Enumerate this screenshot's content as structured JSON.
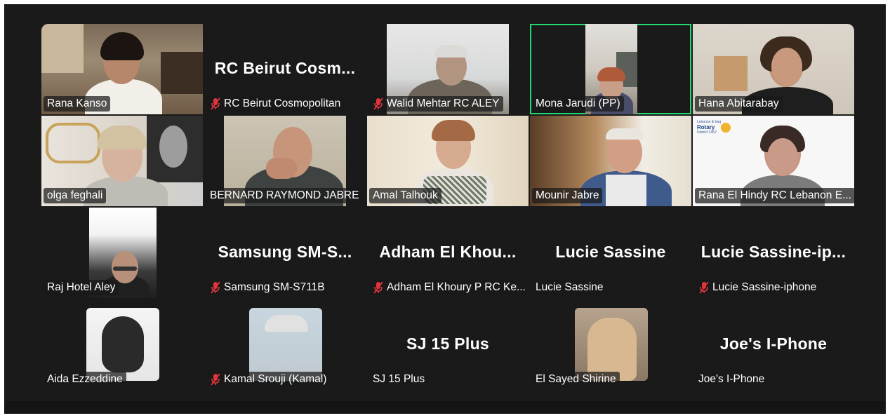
{
  "colors": {
    "background": "#1a1a1a",
    "active_speaker_border": "#23d96f",
    "muted_icon": "#e0353a",
    "label_text": "#ffffff"
  },
  "participants": [
    {
      "name": "Rana Kanso",
      "muted": false,
      "video": true
    },
    {
      "name": "RC Beirut Cosmopolitan",
      "display_name": "RC Beirut Cosm...",
      "muted": true,
      "video": false
    },
    {
      "name": "Walid Mehtar RC ALEY",
      "muted": true,
      "video": true
    },
    {
      "name": "Mona Jarudi (PP)",
      "muted": false,
      "video": true,
      "active_speaker": true
    },
    {
      "name": "Hana Abitarabay",
      "muted": false,
      "video": true
    },
    {
      "name": "olga feghali",
      "muted": false,
      "video": true
    },
    {
      "name": "BERNARD RAYMOND  JABRE",
      "muted": false,
      "video": true
    },
    {
      "name": "Amal Talhouk",
      "muted": false,
      "video": true
    },
    {
      "name": "Mounir Jabre",
      "muted": false,
      "video": true
    },
    {
      "name": "Rana El Hindy RC Lebanon E...",
      "muted": false,
      "video": true,
      "background_text": {
        "line1": "Lebanon & Iraq",
        "line2": "Rotary",
        "line3": "District 2452"
      }
    },
    {
      "name": "Raj Hotel Aley",
      "muted": false,
      "video": true
    },
    {
      "name": "Samsung SM-S711B",
      "display_name": "Samsung  SM-S...",
      "muted": true,
      "video": false
    },
    {
      "name": "Adham El Khoury P RC Ke...",
      "display_name": "Adham  El  Khou...",
      "muted": true,
      "video": false
    },
    {
      "name": "Lucie Sassine",
      "display_name": "Lucie Sassine",
      "muted": false,
      "video": false
    },
    {
      "name": "Lucie Sassine-iphone",
      "display_name": "Lucie  Sassine-ip...",
      "muted": true,
      "video": false
    },
    {
      "name": "Aida Ezzeddine",
      "muted": false,
      "video": true,
      "avatar": true
    },
    {
      "name": "Kamal Srouji (Kamal)",
      "muted": true,
      "video": true,
      "avatar": true
    },
    {
      "name": "SJ 15 Plus",
      "display_name": "SJ 15 Plus",
      "muted": false,
      "video": false
    },
    {
      "name": "El Sayed Shirine",
      "muted": false,
      "video": true,
      "avatar": true
    },
    {
      "name": "Joe's I-Phone",
      "display_name": "Joe's I-Phone",
      "muted": false,
      "video": false
    }
  ]
}
